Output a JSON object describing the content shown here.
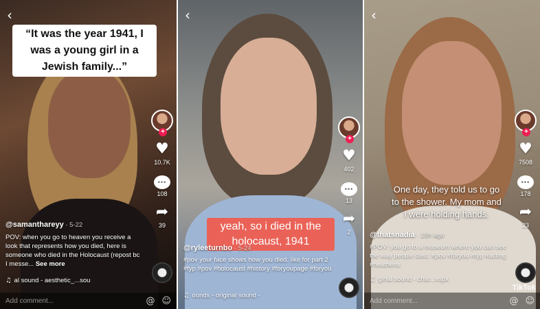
{
  "panels": [
    {
      "back_icon": "‹",
      "overlay": "“It was the year 1941, I was a young girl in a Jewish family...”",
      "likes": "10.7K",
      "comments": "108",
      "shares": "39",
      "username": "@samanthareyy",
      "date": "5-22",
      "caption": "POV: when you go to heaven you receive a look that represents how you died, here is someone who died in the Holocaust (repost bc I messe...",
      "see_more": "See more",
      "sound": "al sound - aesthetic_...sou",
      "comment_placeholder": "Add comment..."
    },
    {
      "back_icon": "‹",
      "overlay": "yeah, so i died in the holocaust, 1941",
      "likes": "402",
      "comments": "13",
      "shares": "2",
      "username": "@ryleeturnbo",
      "date": "5-24",
      "caption": "#pov your face shows how you died. like for part 2 #fyp #pov #holocaust #history #foryoupage #foryou",
      "sound": "ounds - original sound -",
      "comment_placeholder": ""
    },
    {
      "back_icon": "‹",
      "overlay": "One day, they told us to go to the shower. My mom and I were holding hands.",
      "likes": "7508",
      "comments": "178",
      "shares": "23",
      "username": "@thatsnadia",
      "date": "19h ago",
      "caption": "#POV: you go to a museum where you can see the way people died. #pov #foryou #fyp #acting #heathens",
      "sound": "ginal sound - char...vspx",
      "comment_placeholder": "Add comment...",
      "watermark": "TikTok"
    }
  ],
  "icons": {
    "like": "heart-icon",
    "comment": "comment-bubble-icon",
    "share": "share-arrow-icon",
    "music": "music-note-icon",
    "mention": "at-sign-icon",
    "emoji": "emoji-icon"
  },
  "colors": {
    "accent": "#ee1d52",
    "caption_box": "#ee5e50"
  }
}
